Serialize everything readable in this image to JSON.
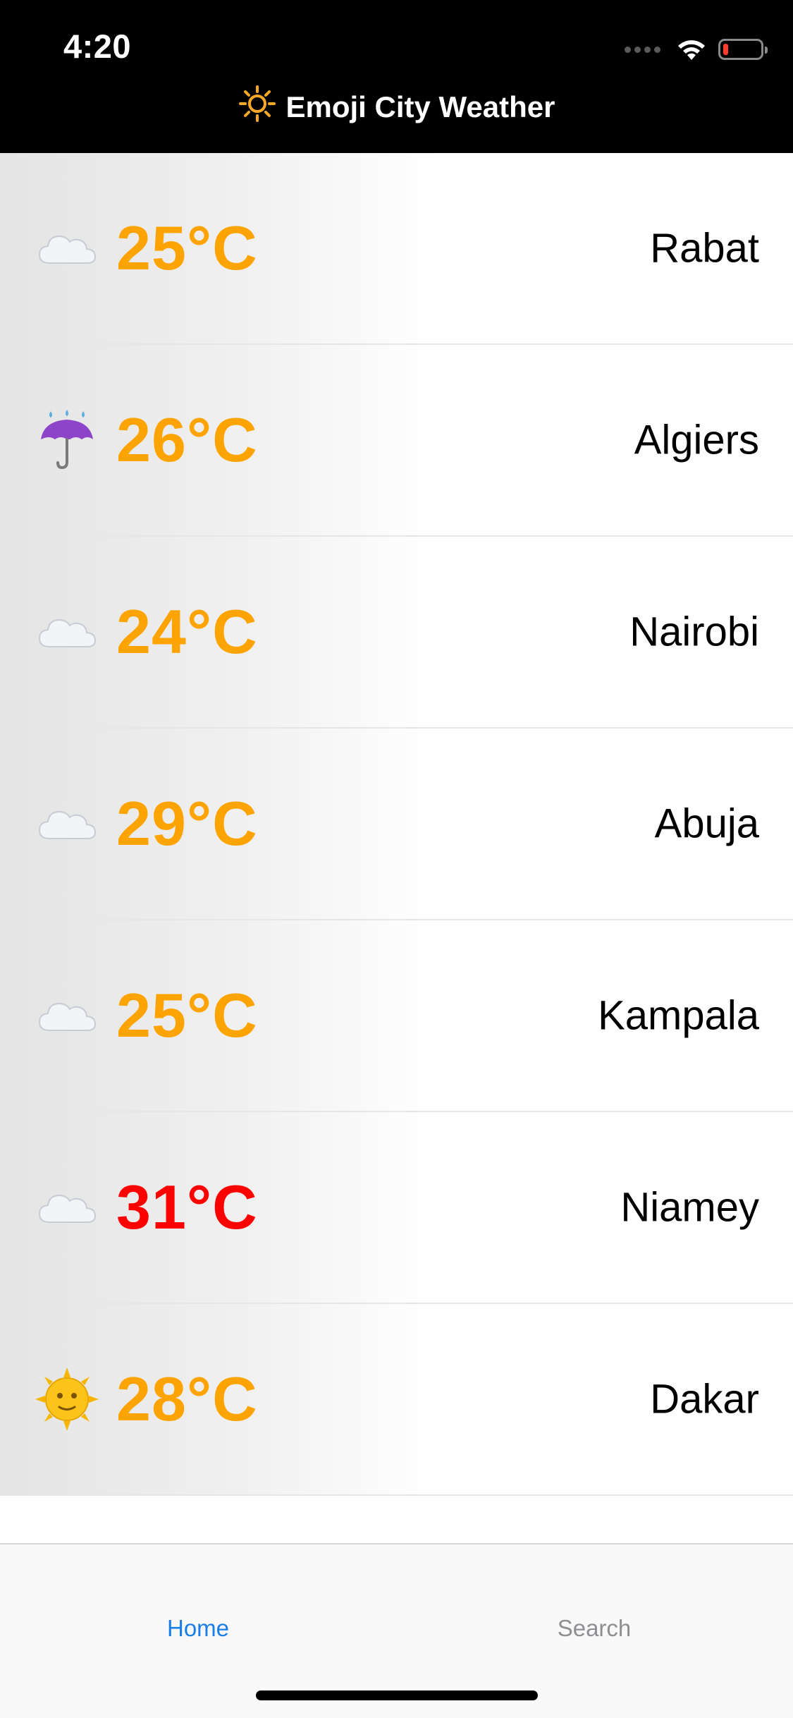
{
  "status_bar": {
    "time": "4:20"
  },
  "nav": {
    "title": "Emoji City Weather",
    "icon": "sun-icon"
  },
  "cities": [
    {
      "temp": "25°C",
      "city": "Rabat",
      "weather_icon": "cloud-icon",
      "temp_color": "#fda402"
    },
    {
      "temp": "26°C",
      "city": "Algiers",
      "weather_icon": "umbrella-rain-icon",
      "temp_color": "#fda402"
    },
    {
      "temp": "24°C",
      "city": "Nairobi",
      "weather_icon": "cloud-icon",
      "temp_color": "#fda402"
    },
    {
      "temp": "29°C",
      "city": "Abuja",
      "weather_icon": "cloud-icon",
      "temp_color": "#fda402"
    },
    {
      "temp": "25°C",
      "city": "Kampala",
      "weather_icon": "cloud-icon",
      "temp_color": "#fda402"
    },
    {
      "temp": "31°C",
      "city": "Niamey",
      "weather_icon": "cloud-icon",
      "temp_color": "#ff0000"
    },
    {
      "temp": "28°C",
      "city": "Dakar",
      "weather_icon": "sun-face-icon",
      "temp_color": "#fda402"
    }
  ],
  "tabbar": {
    "home_label": "Home",
    "search_label": "Search",
    "active_color": "#1a7ee8",
    "inactive_color": "#8e8e93"
  }
}
